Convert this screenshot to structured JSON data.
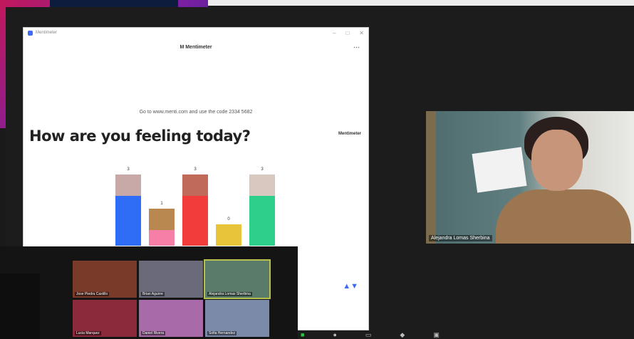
{
  "background": {
    "sun_glyph": "✺"
  },
  "shared_screen": {
    "window_title": "Mentimeter",
    "window_controls": [
      "–",
      "□",
      "✕"
    ],
    "header_title": "M Mentimeter",
    "menu_icon": "menu-icon",
    "join_instructions": "Go to www.menti.com and use the code 2334 5682",
    "question": "How are you feeling today?",
    "brand": "Mentimeter",
    "scroll_indicator": "▲▼"
  },
  "chart_data": {
    "type": "bar",
    "categories": [
      "",
      "",
      "",
      "",
      ""
    ],
    "values": [
      3,
      1,
      3,
      0,
      3
    ],
    "value_labels": [
      "3",
      "1",
      "3",
      "0",
      "3"
    ],
    "colors": [
      "#2f6df6",
      "#f57fa6",
      "#f23b3b",
      "#f7e24a",
      "#2ecf8a"
    ],
    "image_colors": [
      "#c9a8a8",
      "#b88850",
      "#c06a5a",
      "#e8c43a",
      "#d8c8c0"
    ],
    "ylim": [
      0,
      4
    ]
  },
  "speaker": {
    "name": "Alejandra Lomas Sherbina"
  },
  "gallery": {
    "tiles": [
      {
        "name": "Jose Piedra Castillo",
        "bg": "#7a3a2a"
      },
      {
        "name": "Brian Aguirre",
        "bg": "#6a6a7a"
      },
      {
        "name": "Alejandra Lomas Sherbina",
        "bg": "#5a7a6a",
        "active": true
      },
      {
        "name": "Lucia Marquez",
        "bg": "#8a2a3a"
      },
      {
        "name": "Daniel Rivera",
        "bg": "#a86aa8"
      },
      {
        "name": "Sofia Hernandez",
        "bg": "#7a8aa8"
      }
    ]
  },
  "toolbar": {
    "items": [
      "■",
      "●",
      "▭",
      "◆",
      "▣"
    ]
  }
}
